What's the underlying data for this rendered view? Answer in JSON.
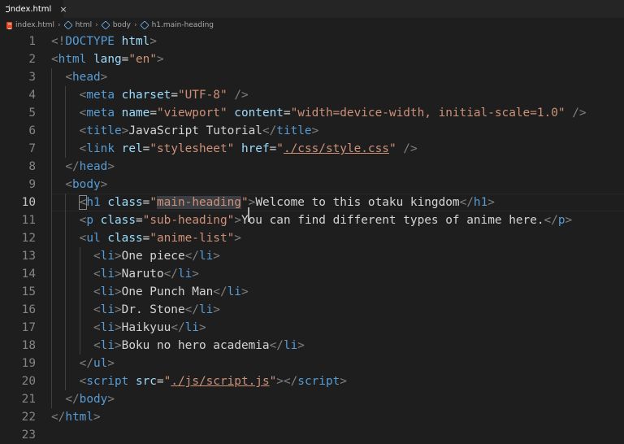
{
  "tab": {
    "filename": "index.html",
    "close_glyph": "×",
    "icon": "html5-icon"
  },
  "breadcrumb": [
    "index.html",
    "html",
    "body",
    "h1.main-heading"
  ],
  "active_line": 10,
  "lines": [
    {
      "n": 1,
      "indent": 0,
      "tokens": [
        [
          "brk",
          "<!"
        ],
        [
          "tag",
          "DOCTYPE"
        ],
        [
          "text",
          " "
        ],
        [
          "attr",
          "html"
        ],
        [
          "brk",
          ">"
        ]
      ]
    },
    {
      "n": 2,
      "indent": 0,
      "tokens": [
        [
          "brk",
          "<"
        ],
        [
          "tag",
          "html"
        ],
        [
          "text",
          " "
        ],
        [
          "attr",
          "lang"
        ],
        [
          "text",
          "="
        ],
        [
          "str",
          "\"en\""
        ],
        [
          "brk",
          ">"
        ]
      ]
    },
    {
      "n": 3,
      "indent": 1,
      "tokens": [
        [
          "brk",
          "<"
        ],
        [
          "tag",
          "head"
        ],
        [
          "brk",
          ">"
        ]
      ]
    },
    {
      "n": 4,
      "indent": 2,
      "tokens": [
        [
          "brk",
          "<"
        ],
        [
          "tag",
          "meta"
        ],
        [
          "text",
          " "
        ],
        [
          "attr",
          "charset"
        ],
        [
          "text",
          "="
        ],
        [
          "str",
          "\"UTF-8\""
        ],
        [
          "text",
          " "
        ],
        [
          "brk",
          "/>"
        ]
      ]
    },
    {
      "n": 5,
      "indent": 2,
      "tokens": [
        [
          "brk",
          "<"
        ],
        [
          "tag",
          "meta"
        ],
        [
          "text",
          " "
        ],
        [
          "attr",
          "name"
        ],
        [
          "text",
          "="
        ],
        [
          "str",
          "\"viewport\""
        ],
        [
          "text",
          " "
        ],
        [
          "attr",
          "content"
        ],
        [
          "text",
          "="
        ],
        [
          "str",
          "\"width=device-width, initial-scale=1.0\""
        ],
        [
          "text",
          " "
        ],
        [
          "brk",
          "/>"
        ]
      ]
    },
    {
      "n": 6,
      "indent": 2,
      "tokens": [
        [
          "brk",
          "<"
        ],
        [
          "tag",
          "title"
        ],
        [
          "brk",
          ">"
        ],
        [
          "text",
          "JavaScript Tutorial"
        ],
        [
          "brk",
          "</"
        ],
        [
          "tag",
          "title"
        ],
        [
          "brk",
          ">"
        ]
      ]
    },
    {
      "n": 7,
      "indent": 2,
      "tokens": [
        [
          "brk",
          "<"
        ],
        [
          "tag",
          "link"
        ],
        [
          "text",
          " "
        ],
        [
          "attr",
          "rel"
        ],
        [
          "text",
          "="
        ],
        [
          "str",
          "\"stylesheet\""
        ],
        [
          "text",
          " "
        ],
        [
          "attr",
          "href"
        ],
        [
          "text",
          "="
        ],
        [
          "str",
          "\""
        ],
        [
          "strul",
          "./css/style.css"
        ],
        [
          "str",
          "\""
        ],
        [
          "text",
          " "
        ],
        [
          "brk",
          "/>"
        ]
      ]
    },
    {
      "n": 8,
      "indent": 1,
      "tokens": [
        [
          "brk",
          "</"
        ],
        [
          "tag",
          "head"
        ],
        [
          "brk",
          ">"
        ]
      ]
    },
    {
      "n": 9,
      "indent": 1,
      "tokens": [
        [
          "brk",
          "<"
        ],
        [
          "tag",
          "body"
        ],
        [
          "brk",
          ">"
        ]
      ]
    },
    {
      "n": 10,
      "indent": 2,
      "tokens": [
        [
          "brkbox",
          "<"
        ],
        [
          "tag",
          "h1"
        ],
        [
          "text",
          " "
        ],
        [
          "attr",
          "class"
        ],
        [
          "text",
          "="
        ],
        [
          "str",
          "\""
        ],
        [
          "strhl",
          "main-heading"
        ],
        [
          "str",
          "\""
        ],
        [
          "cursor",
          ""
        ],
        [
          "brk",
          ">"
        ],
        [
          "text",
          "Welcome to this otaku kingdom"
        ],
        [
          "brk",
          "</"
        ],
        [
          "tag",
          "h1"
        ],
        [
          "brk",
          ">"
        ]
      ]
    },
    {
      "n": 11,
      "indent": 2,
      "tokens": [
        [
          "brk",
          "<"
        ],
        [
          "tag",
          "p"
        ],
        [
          "text",
          " "
        ],
        [
          "attr",
          "class"
        ],
        [
          "text",
          "="
        ],
        [
          "str",
          "\"sub-heading\""
        ],
        [
          "brk",
          ">"
        ],
        [
          "text",
          "You can find different types of anime here."
        ],
        [
          "brk",
          "</"
        ],
        [
          "tag",
          "p"
        ],
        [
          "brk",
          ">"
        ]
      ]
    },
    {
      "n": 12,
      "indent": 2,
      "tokens": [
        [
          "brk",
          "<"
        ],
        [
          "tag",
          "ul"
        ],
        [
          "text",
          " "
        ],
        [
          "attr",
          "class"
        ],
        [
          "text",
          "="
        ],
        [
          "str",
          "\"anime-list\""
        ],
        [
          "brk",
          ">"
        ]
      ]
    },
    {
      "n": 13,
      "indent": 3,
      "tokens": [
        [
          "brk",
          "<"
        ],
        [
          "tag",
          "li"
        ],
        [
          "brk",
          ">"
        ],
        [
          "text",
          "One piece"
        ],
        [
          "brk",
          "</"
        ],
        [
          "tag",
          "li"
        ],
        [
          "brk",
          ">"
        ]
      ]
    },
    {
      "n": 14,
      "indent": 3,
      "tokens": [
        [
          "brk",
          "<"
        ],
        [
          "tag",
          "li"
        ],
        [
          "brk",
          ">"
        ],
        [
          "text",
          "Naruto"
        ],
        [
          "brk",
          "</"
        ],
        [
          "tag",
          "li"
        ],
        [
          "brk",
          ">"
        ]
      ]
    },
    {
      "n": 15,
      "indent": 3,
      "tokens": [
        [
          "brk",
          "<"
        ],
        [
          "tag",
          "li"
        ],
        [
          "brk",
          ">"
        ],
        [
          "text",
          "One Punch Man"
        ],
        [
          "brk",
          "</"
        ],
        [
          "tag",
          "li"
        ],
        [
          "brk",
          ">"
        ]
      ]
    },
    {
      "n": 16,
      "indent": 3,
      "tokens": [
        [
          "brk",
          "<"
        ],
        [
          "tag",
          "li"
        ],
        [
          "brk",
          ">"
        ],
        [
          "text",
          "Dr. Stone"
        ],
        [
          "brk",
          "</"
        ],
        [
          "tag",
          "li"
        ],
        [
          "brk",
          ">"
        ]
      ]
    },
    {
      "n": 17,
      "indent": 3,
      "tokens": [
        [
          "brk",
          "<"
        ],
        [
          "tag",
          "li"
        ],
        [
          "brk",
          ">"
        ],
        [
          "text",
          "Haikyuu"
        ],
        [
          "brk",
          "</"
        ],
        [
          "tag",
          "li"
        ],
        [
          "brk",
          ">"
        ]
      ]
    },
    {
      "n": 18,
      "indent": 3,
      "tokens": [
        [
          "brk",
          "<"
        ],
        [
          "tag",
          "li"
        ],
        [
          "brk",
          ">"
        ],
        [
          "text",
          "Boku no hero academia"
        ],
        [
          "brk",
          "</"
        ],
        [
          "tag",
          "li"
        ],
        [
          "brk",
          ">"
        ]
      ]
    },
    {
      "n": 19,
      "indent": 2,
      "tokens": [
        [
          "brk",
          "</"
        ],
        [
          "tag",
          "ul"
        ],
        [
          "brk",
          ">"
        ]
      ]
    },
    {
      "n": 20,
      "indent": 2,
      "tokens": [
        [
          "brk",
          "<"
        ],
        [
          "tag",
          "script"
        ],
        [
          "text",
          " "
        ],
        [
          "attr",
          "src"
        ],
        [
          "text",
          "="
        ],
        [
          "str",
          "\""
        ],
        [
          "strul",
          "./js/script.js"
        ],
        [
          "str",
          "\""
        ],
        [
          "brk",
          "></"
        ],
        [
          "tag",
          "script"
        ],
        [
          "brk",
          ">"
        ]
      ]
    },
    {
      "n": 21,
      "indent": 1,
      "tokens": [
        [
          "brk",
          "</"
        ],
        [
          "tag",
          "body"
        ],
        [
          "brk",
          ">"
        ]
      ]
    },
    {
      "n": 22,
      "indent": 0,
      "tokens": [
        [
          "brk",
          "</"
        ],
        [
          "tag",
          "html"
        ],
        [
          "brk",
          ">"
        ]
      ]
    },
    {
      "n": 23,
      "indent": 0,
      "tokens": []
    }
  ]
}
